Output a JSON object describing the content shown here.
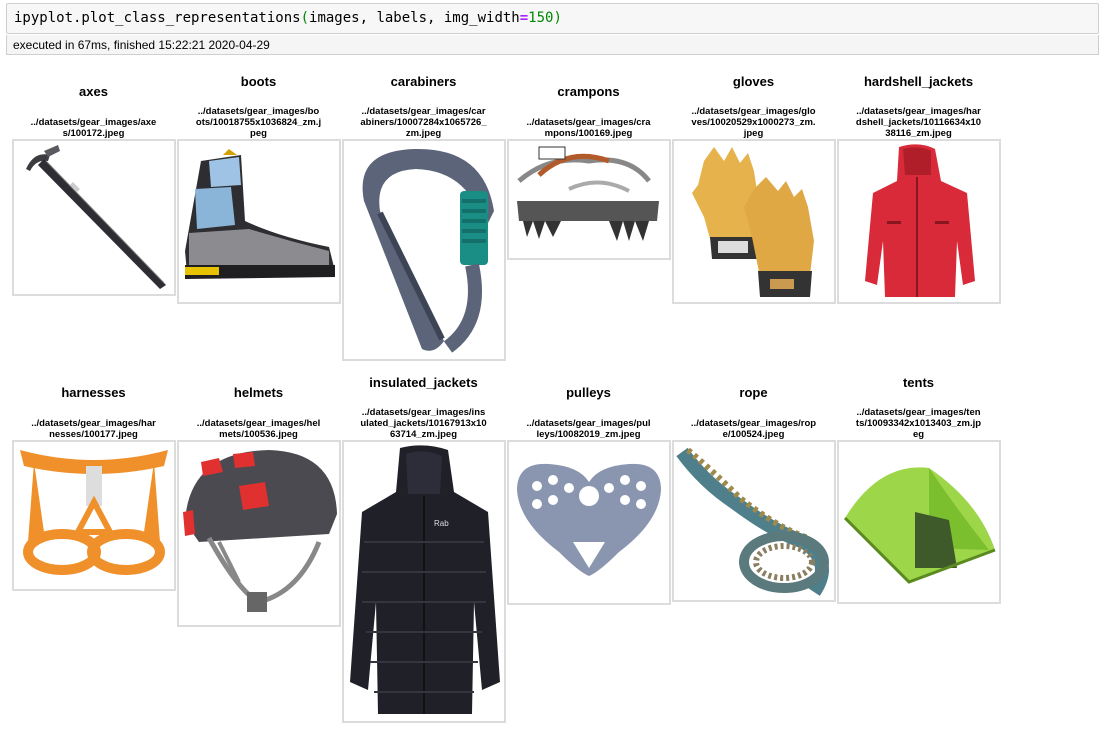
{
  "code": {
    "func": "ipyplot.plot_class_representations",
    "args": "images, labels, img_width",
    "eq": "=",
    "value": "150"
  },
  "execution": "executed in 67ms, finished 15:22:21 2020-04-29",
  "grid": [
    {
      "label": "axes",
      "file": "../datasets/gear_images/axe\ns/100172.jpeg",
      "icon": "ice-axe-icon"
    },
    {
      "label": "boots",
      "file": "../datasets/gear_images/bo\nots/10018755x1036824_zm.j\npeg",
      "icon": "boot-icon"
    },
    {
      "label": "carabiners",
      "file": "../datasets/gear_images/car\nabiners/10007284x1065726_\nzm.jpeg",
      "icon": "carabiner-icon"
    },
    {
      "label": "crampons",
      "file": "../datasets/gear_images/cra\nmpons/100169.jpeg",
      "icon": "crampon-icon"
    },
    {
      "label": "gloves",
      "file": "../datasets/gear_images/glo\nves/10020529x1000273_zm.\njpeg",
      "icon": "glove-icon"
    },
    {
      "label": "hardshell_jackets",
      "file": "../datasets/gear_images/har\ndshell_jackets/10116634x10\n38116_zm.jpeg",
      "icon": "hardshell-jacket-icon"
    },
    {
      "label": "harnesses",
      "file": "../datasets/gear_images/har\nnesses/100177.jpeg",
      "icon": "harness-icon"
    },
    {
      "label": "helmets",
      "file": "../datasets/gear_images/hel\nmets/100536.jpeg",
      "icon": "helmet-icon"
    },
    {
      "label": "insulated_jackets",
      "file": "../datasets/gear_images/ins\nulated_jackets/10167913x10\n63714_zm.jpeg",
      "icon": "insulated-jacket-icon"
    },
    {
      "label": "pulleys",
      "file": "../datasets/gear_images/pul\nleys/10082019_zm.jpeg",
      "icon": "pulley-icon"
    },
    {
      "label": "rope",
      "file": "../datasets/gear_images/rop\ne/100524.jpeg",
      "icon": "rope-icon"
    },
    {
      "label": "tents",
      "file": "../datasets/gear_images/ten\nts/10093342x1013403_zm.jp\neg",
      "icon": "tent-icon"
    }
  ]
}
